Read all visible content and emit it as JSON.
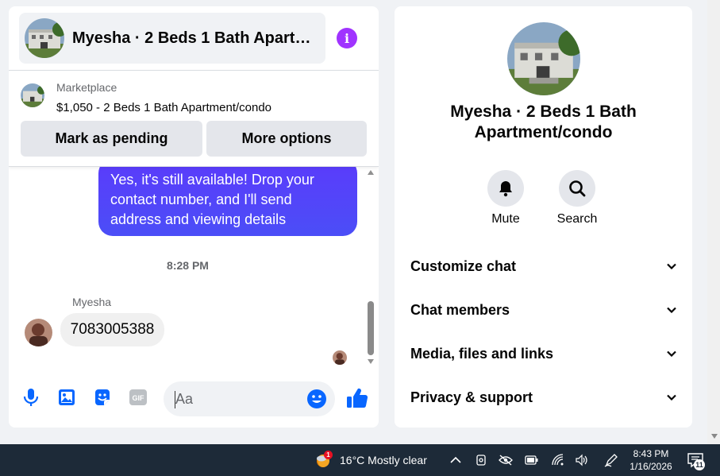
{
  "chat": {
    "title": "Myesha · 2 Beds 1 Bath Apartment/condo",
    "marketplace": {
      "label": "Marketplace",
      "listing": "$1,050 - 2 Beds 1 Bath Apartment/condo",
      "pending_button": "Mark as pending",
      "more_button": "More options"
    },
    "messages": {
      "outgoing_text": "Yes, it's still available! Drop your contact number, and I'll send address and viewing details",
      "timestamp": "8:28 PM",
      "sender_name": "Myesha",
      "incoming_text": "7083005388"
    },
    "composer": {
      "placeholder": "Aa"
    }
  },
  "info_panel": {
    "title": "Myesha · 2 Beds 1 Bath Apartment/condo",
    "actions": {
      "mute": "Mute",
      "search": "Search"
    },
    "sections": {
      "customize": "Customize chat",
      "members": "Chat members",
      "media": "Media, files and links",
      "privacy": "Privacy & support"
    }
  },
  "taskbar": {
    "weather_badge": "1",
    "weather": "16°C  Mostly clear",
    "time": "8:43 PM",
    "date": "1/16/2026",
    "notification_count": "11"
  },
  "colors": {
    "accent": "#0866ff",
    "bubble": "#4f46f8",
    "info": "#a033ff",
    "taskbar": "#1d2a38"
  }
}
